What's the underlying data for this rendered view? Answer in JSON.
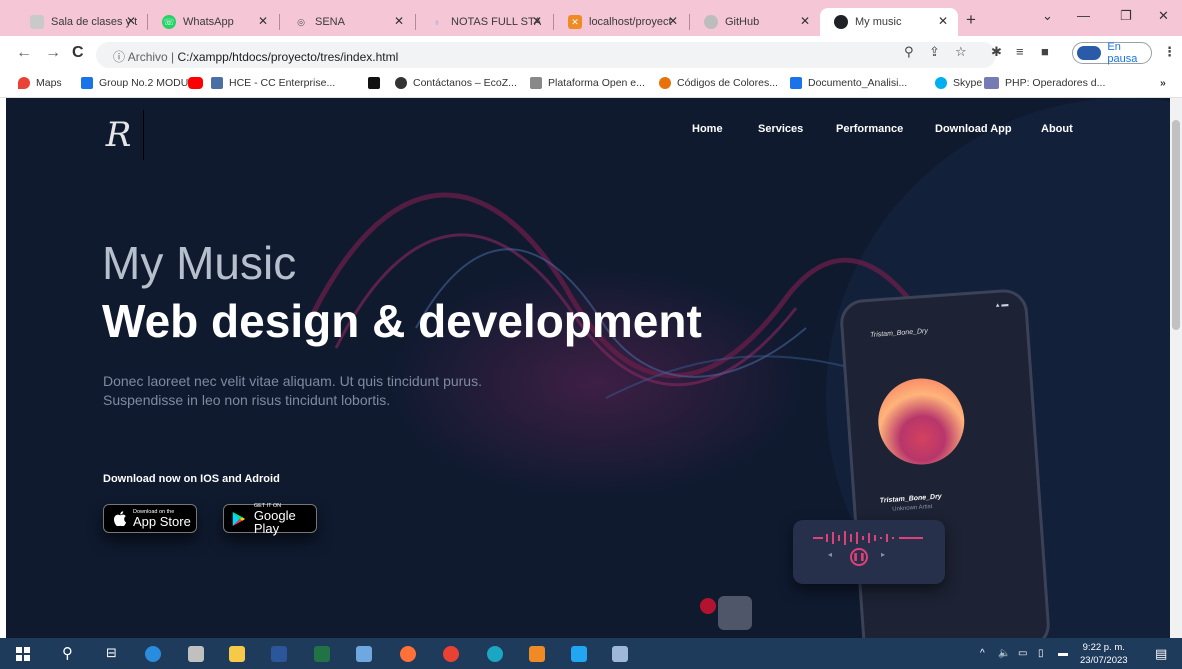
{
  "tabs": [
    {
      "title": "Sala de clases y t",
      "icon": "google-classroom-icon",
      "color": "#9aa0a6"
    },
    {
      "title": "WhatsApp",
      "icon": "whatsapp-icon",
      "color": "#25d366"
    },
    {
      "title": "SENA",
      "icon": "sena-icon",
      "color": "#e0e0e0"
    },
    {
      "title": "NOTAS FULL STA",
      "icon": "notion-icon",
      "color": "#7aa7d8"
    },
    {
      "title": "localhost/proyect",
      "icon": "xampp-icon",
      "color": "#f08a24"
    },
    {
      "title": "GitHub",
      "icon": "github-icon",
      "color": "#bdbdbd"
    },
    {
      "title": "My music",
      "icon": "globe-icon",
      "color": "#202124"
    }
  ],
  "toolbar": {
    "url_label": "Archivo",
    "url_path": "C:/xampp/htdocs/proyecto/tres/index.html",
    "profile_label": "En pausa"
  },
  "bookmarks": [
    {
      "label": "Maps",
      "color": "#ea4335"
    },
    {
      "label": "Group No.2 MODU...",
      "color": "#1a73e8"
    },
    {
      "label": "",
      "color": "#ff0000"
    },
    {
      "label": "HCE - CC Enterprise...",
      "color": "#4a6fa5"
    },
    {
      "label": "",
      "color": "#111"
    },
    {
      "label": "Contáctanos – EcoZ...",
      "color": "#333"
    },
    {
      "label": "Plataforma Open e...",
      "color": "#888"
    },
    {
      "label": "Códigos de Colores...",
      "color": "#e8710a"
    },
    {
      "label": "Documento_Analisi...",
      "color": "#1a73e8"
    },
    {
      "label": "Skype",
      "color": "#00aff0"
    },
    {
      "label": "PHP: Operadores d...",
      "color": "#777bb3"
    }
  ],
  "site": {
    "logo": "R",
    "nav": [
      "Home",
      "Services",
      "Performance",
      "Download App",
      "About"
    ],
    "title_line1": "My Music",
    "title_line2": "Web design & development",
    "lead": "Donec laoreet nec velit vitae aliquam. Ut quis tincidunt purus. Suspendisse in leo non risus tincidunt lobortis.",
    "download_label": "Download now on IOS and Adroid",
    "appstore_small": "Download on the",
    "appstore_big": "App Store",
    "gplay_small": "GET IT ON",
    "gplay_big": "Google Play"
  },
  "phone": {
    "track_top": "Tristam_Bone_Dry",
    "track": "Tristam_Bone_Dry",
    "artist": "Unknown Artist"
  },
  "taskbar": {
    "time": "9:22 p. m.",
    "date": "23/07/2023"
  },
  "colors": {
    "page_bg": "#0f1a2f",
    "tab_strip": "#f4c6d6",
    "accent": "#e0407a"
  }
}
